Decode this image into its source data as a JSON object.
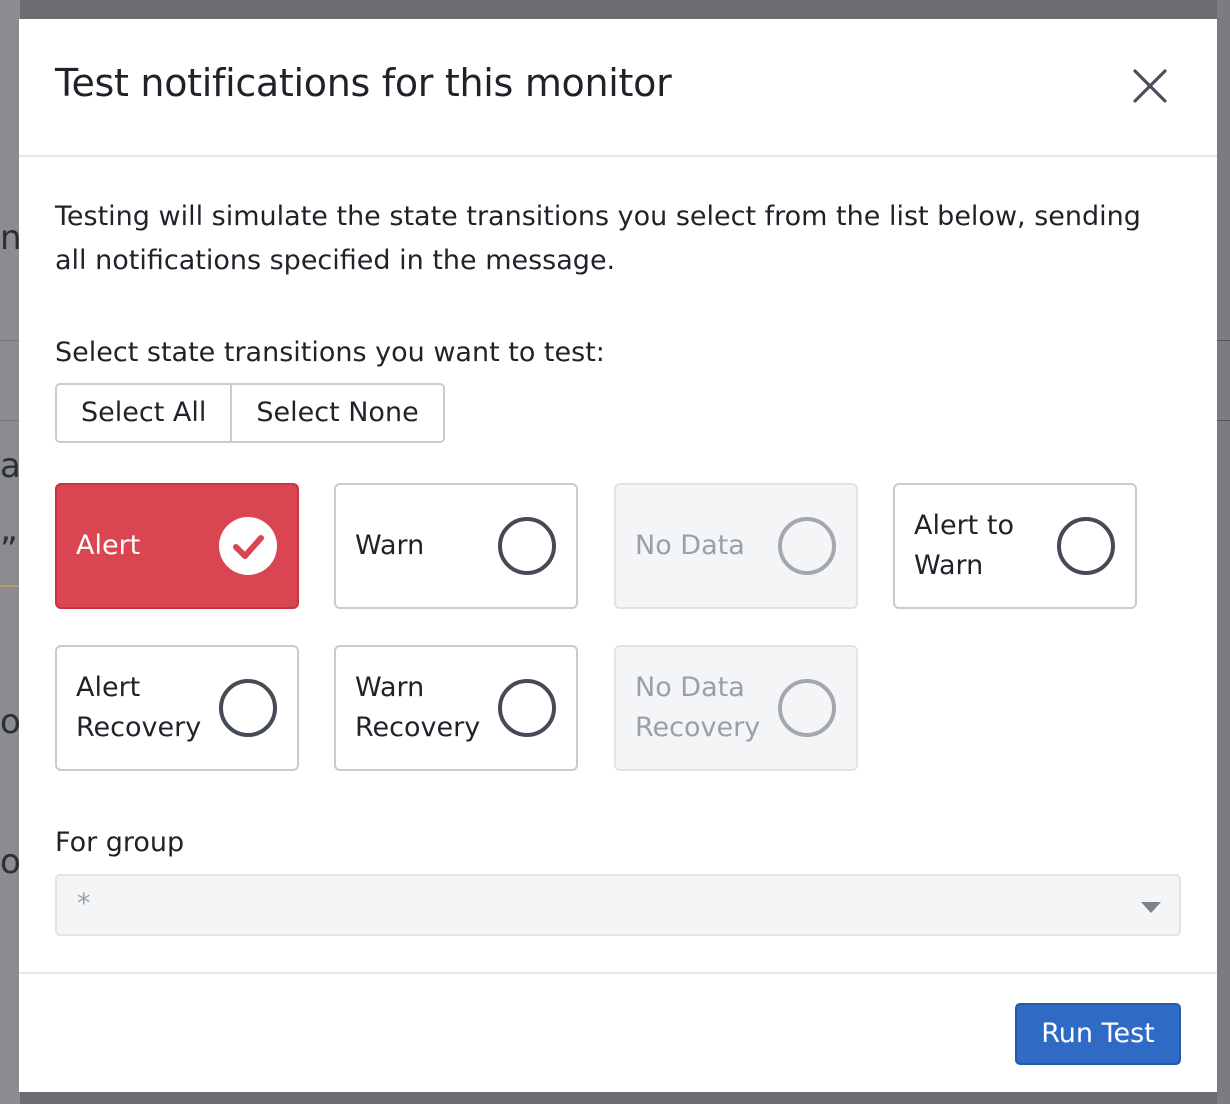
{
  "dialog": {
    "title": "Test notifications for this monitor",
    "description": "Testing will simulate the state transitions you select from the list below, sending all notifications specified in the message.",
    "section_label": "Select state transitions you want to test:",
    "select_all_label": "Select All",
    "select_none_label": "Select None",
    "transitions": [
      {
        "label": "Alert",
        "state": "selected"
      },
      {
        "label": "Warn",
        "state": "unselected"
      },
      {
        "label": "No Data",
        "state": "disabled"
      },
      {
        "label": "Alert to Warn",
        "state": "unselected"
      },
      {
        "label": "Alert Recovery",
        "state": "unselected"
      },
      {
        "label": "Warn Recovery",
        "state": "unselected"
      },
      {
        "label": "No Data Recovery",
        "state": "disabled"
      }
    ],
    "group_label": "For group",
    "group_value": "*",
    "run_label": "Run Test"
  },
  "background": {
    "glyphs": [
      "n",
      "at",
      "”",
      "o",
      "o"
    ]
  },
  "colors": {
    "selected": "#d94652",
    "primary": "#2f6bc5"
  }
}
